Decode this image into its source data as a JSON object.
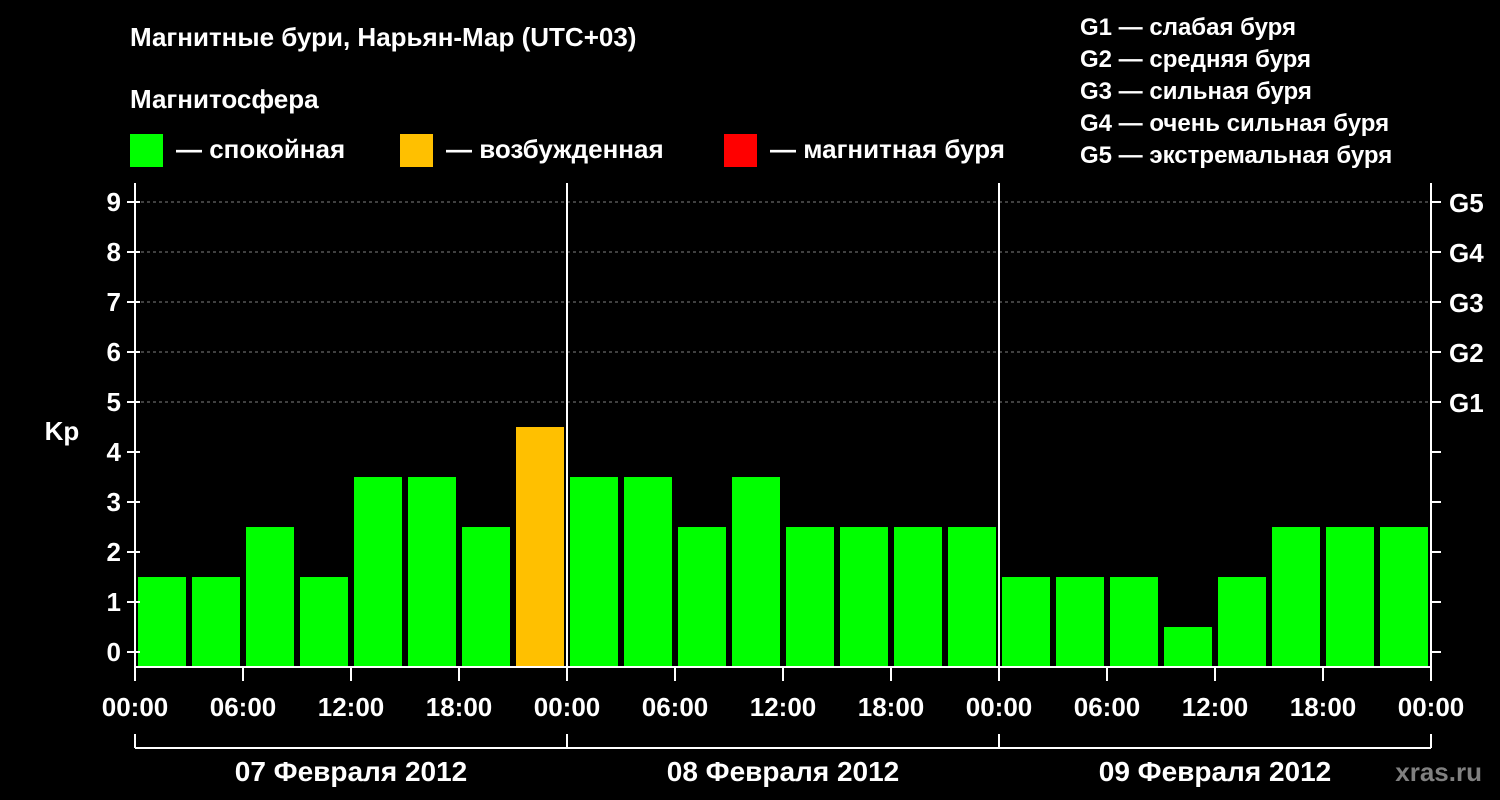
{
  "chart_data": {
    "type": "bar",
    "title": "Магнитные бури, Нарьян-Мар (UTC+03)",
    "ylabel": "Kp",
    "ylim": [
      0,
      9
    ],
    "yticks": [
      "0",
      "1",
      "2",
      "3",
      "4",
      "5",
      "6",
      "7",
      "8",
      "9"
    ],
    "right_ticks": [
      {
        "kp": 5,
        "label": "G1"
      },
      {
        "kp": 6,
        "label": "G2"
      },
      {
        "kp": 7,
        "label": "G3"
      },
      {
        "kp": 8,
        "label": "G4"
      },
      {
        "kp": 9,
        "label": "G5"
      }
    ],
    "xtick_labels": [
      "00:00",
      "06:00",
      "12:00",
      "18:00",
      "00:00",
      "06:00",
      "12:00",
      "18:00",
      "00:00",
      "06:00",
      "12:00",
      "18:00",
      "00:00"
    ],
    "days": [
      "07 Февраля 2012",
      "08 Февраля 2012",
      "09 Февраля 2012"
    ],
    "values": [
      1,
      1,
      2,
      1,
      3,
      3,
      2,
      4,
      3,
      3,
      2,
      3,
      2,
      2,
      2,
      2,
      1,
      1,
      1,
      0,
      1,
      2,
      2,
      2
    ],
    "grid": true,
    "grid_from_kp": 5,
    "colors": {
      "calm": "#00ff00",
      "excited": "#ffc000",
      "storm": "#ff0000",
      "axis": "#ffffff",
      "grid": "#808080",
      "background": "#000000"
    },
    "legend": {
      "heading": "Магнитосфера",
      "position": "top-left",
      "items": [
        {
          "key": "calm",
          "label": "— спокойная"
        },
        {
          "key": "excited",
          "label": "— возбужденная"
        },
        {
          "key": "storm",
          "label": "— магнитная буря"
        }
      ]
    },
    "g_scale": [
      "G1 — слабая буря",
      "G2 — средняя буря",
      "G3 — сильная буря",
      "G4 — очень сильная буря",
      "G5 — экстремальная буря"
    ],
    "watermark": "xras.ru"
  }
}
